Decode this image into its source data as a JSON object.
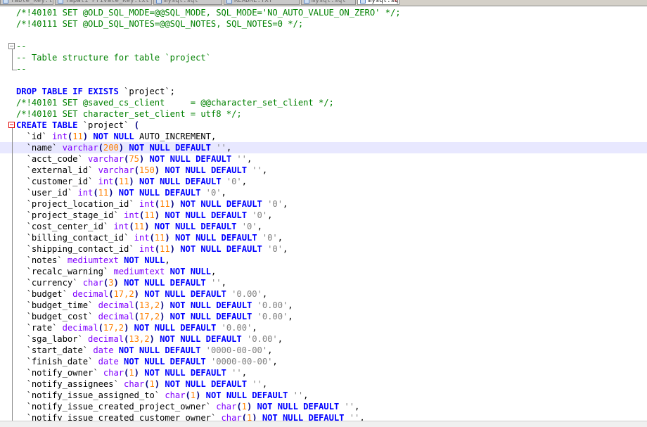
{
  "tabs": [
    {
      "label": "Table_Key.txt",
      "active": false
    },
    {
      "label": "Yapali Private_Key.txt",
      "active": false
    },
    {
      "label": "mysql.sql",
      "active": false
    },
    {
      "label": "README.TXT",
      "active": false
    },
    {
      "label": "mysql.sql",
      "active": false
    },
    {
      "label": "mysql.sql",
      "active": true
    }
  ],
  "icons": {
    "tab": "document-icon",
    "close": "close-icon",
    "fold_open": "fold-minus-icon"
  },
  "colors": {
    "comment": "#008000",
    "keyword": "#0000ff",
    "type": "#8000ff",
    "number": "#ff8000",
    "string": "#808080",
    "operator": "#000080",
    "current_line": "#e8e8ff",
    "fold_marker_active": "#e00000",
    "fold_marker": "#808080"
  },
  "editor": {
    "current_line_index": 12,
    "lines": [
      {
        "tokens": [
          {
            "t": "/*!40101 SET @OLD_SQL_MODE=@@SQL_MODE, SQL_MODE='NO_AUTO_VALUE_ON_ZERO' */;",
            "c": "comment"
          }
        ]
      },
      {
        "tokens": [
          {
            "t": "/*!40111 SET @OLD_SQL_NOTES=@@SQL_NOTES, SQL_NOTES=0 */;",
            "c": "comment"
          }
        ]
      },
      {
        "tokens": []
      },
      {
        "fold": "start",
        "tokens": [
          {
            "t": "--",
            "c": "comment"
          }
        ]
      },
      {
        "fold": "mid",
        "tokens": [
          {
            "t": "-- Table structure for table `project`",
            "c": "comment"
          }
        ]
      },
      {
        "fold": "end",
        "tokens": [
          {
            "t": "--",
            "c": "comment"
          }
        ]
      },
      {
        "tokens": []
      },
      {
        "tokens": [
          {
            "t": "DROP TABLE IF EXISTS",
            "c": "kw"
          },
          {
            "t": " `project`;",
            "c": "plain"
          }
        ]
      },
      {
        "tokens": [
          {
            "t": "/*!40101 SET @saved_cs_client     = @@character_set_client */;",
            "c": "comment"
          }
        ]
      },
      {
        "tokens": [
          {
            "t": "/*!40101 SET character_set_client = utf8 */;",
            "c": "comment"
          }
        ]
      },
      {
        "fold": "start-red",
        "tokens": [
          {
            "t": "CREATE TABLE",
            "c": "kw"
          },
          {
            "t": " `project` ",
            "c": "plain"
          },
          {
            "t": "(",
            "c": "op"
          }
        ]
      },
      {
        "fold": "mid",
        "tokens": [
          {
            "t": "  `id` ",
            "c": "plain"
          },
          {
            "t": "int",
            "c": "type"
          },
          {
            "t": "(",
            "c": "op"
          },
          {
            "t": "11",
            "c": "num"
          },
          {
            "t": ")",
            "c": "op"
          },
          {
            "t": " NOT NULL",
            "c": "kw"
          },
          {
            "t": " AUTO_INCREMENT,",
            "c": "plain"
          }
        ]
      },
      {
        "fold": "mid",
        "tokens": [
          {
            "t": "  `name` ",
            "c": "plain"
          },
          {
            "t": "varchar",
            "c": "type"
          },
          {
            "t": "(",
            "c": "op"
          },
          {
            "t": "200",
            "c": "num"
          },
          {
            "t": ")",
            "c": "op"
          },
          {
            "t": " NOT NULL DEFAULT",
            "c": "kw"
          },
          {
            "t": " ''",
            "c": "str"
          },
          {
            "t": ",",
            "c": "plain"
          }
        ]
      },
      {
        "fold": "mid",
        "tokens": [
          {
            "t": "  `acct_code` ",
            "c": "plain"
          },
          {
            "t": "varchar",
            "c": "type"
          },
          {
            "t": "(",
            "c": "op"
          },
          {
            "t": "75",
            "c": "num"
          },
          {
            "t": ")",
            "c": "op"
          },
          {
            "t": " NOT NULL DEFAULT",
            "c": "kw"
          },
          {
            "t": " ''",
            "c": "str"
          },
          {
            "t": ",",
            "c": "plain"
          }
        ]
      },
      {
        "fold": "mid",
        "tokens": [
          {
            "t": "  `external_id` ",
            "c": "plain"
          },
          {
            "t": "varchar",
            "c": "type"
          },
          {
            "t": "(",
            "c": "op"
          },
          {
            "t": "150",
            "c": "num"
          },
          {
            "t": ")",
            "c": "op"
          },
          {
            "t": " NOT NULL DEFAULT",
            "c": "kw"
          },
          {
            "t": " ''",
            "c": "str"
          },
          {
            "t": ",",
            "c": "plain"
          }
        ]
      },
      {
        "fold": "mid",
        "tokens": [
          {
            "t": "  `customer_id` ",
            "c": "plain"
          },
          {
            "t": "int",
            "c": "type"
          },
          {
            "t": "(",
            "c": "op"
          },
          {
            "t": "11",
            "c": "num"
          },
          {
            "t": ")",
            "c": "op"
          },
          {
            "t": " NOT NULL DEFAULT",
            "c": "kw"
          },
          {
            "t": " '0'",
            "c": "str"
          },
          {
            "t": ",",
            "c": "plain"
          }
        ]
      },
      {
        "fold": "mid",
        "tokens": [
          {
            "t": "  `user_id` ",
            "c": "plain"
          },
          {
            "t": "int",
            "c": "type"
          },
          {
            "t": "(",
            "c": "op"
          },
          {
            "t": "11",
            "c": "num"
          },
          {
            "t": ")",
            "c": "op"
          },
          {
            "t": " NOT NULL DEFAULT",
            "c": "kw"
          },
          {
            "t": " '0'",
            "c": "str"
          },
          {
            "t": ",",
            "c": "plain"
          }
        ]
      },
      {
        "fold": "mid",
        "tokens": [
          {
            "t": "  `project_location_id` ",
            "c": "plain"
          },
          {
            "t": "int",
            "c": "type"
          },
          {
            "t": "(",
            "c": "op"
          },
          {
            "t": "11",
            "c": "num"
          },
          {
            "t": ")",
            "c": "op"
          },
          {
            "t": " NOT NULL DEFAULT",
            "c": "kw"
          },
          {
            "t": " '0'",
            "c": "str"
          },
          {
            "t": ",",
            "c": "plain"
          }
        ]
      },
      {
        "fold": "mid",
        "tokens": [
          {
            "t": "  `project_stage_id` ",
            "c": "plain"
          },
          {
            "t": "int",
            "c": "type"
          },
          {
            "t": "(",
            "c": "op"
          },
          {
            "t": "11",
            "c": "num"
          },
          {
            "t": ")",
            "c": "op"
          },
          {
            "t": " NOT NULL DEFAULT",
            "c": "kw"
          },
          {
            "t": " '0'",
            "c": "str"
          },
          {
            "t": ",",
            "c": "plain"
          }
        ]
      },
      {
        "fold": "mid",
        "tokens": [
          {
            "t": "  `cost_center_id` ",
            "c": "plain"
          },
          {
            "t": "int",
            "c": "type"
          },
          {
            "t": "(",
            "c": "op"
          },
          {
            "t": "11",
            "c": "num"
          },
          {
            "t": ")",
            "c": "op"
          },
          {
            "t": " NOT NULL DEFAULT",
            "c": "kw"
          },
          {
            "t": " '0'",
            "c": "str"
          },
          {
            "t": ",",
            "c": "plain"
          }
        ]
      },
      {
        "fold": "mid",
        "tokens": [
          {
            "t": "  `billing_contact_id` ",
            "c": "plain"
          },
          {
            "t": "int",
            "c": "type"
          },
          {
            "t": "(",
            "c": "op"
          },
          {
            "t": "11",
            "c": "num"
          },
          {
            "t": ")",
            "c": "op"
          },
          {
            "t": " NOT NULL DEFAULT",
            "c": "kw"
          },
          {
            "t": " '0'",
            "c": "str"
          },
          {
            "t": ",",
            "c": "plain"
          }
        ]
      },
      {
        "fold": "mid",
        "tokens": [
          {
            "t": "  `shipping_contact_id` ",
            "c": "plain"
          },
          {
            "t": "int",
            "c": "type"
          },
          {
            "t": "(",
            "c": "op"
          },
          {
            "t": "11",
            "c": "num"
          },
          {
            "t": ")",
            "c": "op"
          },
          {
            "t": " NOT NULL DEFAULT",
            "c": "kw"
          },
          {
            "t": " '0'",
            "c": "str"
          },
          {
            "t": ",",
            "c": "plain"
          }
        ]
      },
      {
        "fold": "mid",
        "tokens": [
          {
            "t": "  `notes` ",
            "c": "plain"
          },
          {
            "t": "mediumtext",
            "c": "type"
          },
          {
            "t": " NOT NULL",
            "c": "kw"
          },
          {
            "t": ",",
            "c": "plain"
          }
        ]
      },
      {
        "fold": "mid",
        "tokens": [
          {
            "t": "  `recalc_warning` ",
            "c": "plain"
          },
          {
            "t": "mediumtext",
            "c": "type"
          },
          {
            "t": " NOT NULL",
            "c": "kw"
          },
          {
            "t": ",",
            "c": "plain"
          }
        ]
      },
      {
        "fold": "mid",
        "tokens": [
          {
            "t": "  `currency` ",
            "c": "plain"
          },
          {
            "t": "char",
            "c": "type"
          },
          {
            "t": "(",
            "c": "op"
          },
          {
            "t": "3",
            "c": "num"
          },
          {
            "t": ")",
            "c": "op"
          },
          {
            "t": " NOT NULL DEFAULT",
            "c": "kw"
          },
          {
            "t": " ''",
            "c": "str"
          },
          {
            "t": ",",
            "c": "plain"
          }
        ]
      },
      {
        "fold": "mid",
        "tokens": [
          {
            "t": "  `budget` ",
            "c": "plain"
          },
          {
            "t": "decimal",
            "c": "type"
          },
          {
            "t": "(",
            "c": "op"
          },
          {
            "t": "17,2",
            "c": "num"
          },
          {
            "t": ")",
            "c": "op"
          },
          {
            "t": " NOT NULL DEFAULT",
            "c": "kw"
          },
          {
            "t": " '0.00'",
            "c": "str"
          },
          {
            "t": ",",
            "c": "plain"
          }
        ]
      },
      {
        "fold": "mid",
        "tokens": [
          {
            "t": "  `budget_time` ",
            "c": "plain"
          },
          {
            "t": "decimal",
            "c": "type"
          },
          {
            "t": "(",
            "c": "op"
          },
          {
            "t": "13,2",
            "c": "num"
          },
          {
            "t": ")",
            "c": "op"
          },
          {
            "t": " NOT NULL DEFAULT",
            "c": "kw"
          },
          {
            "t": " '0.00'",
            "c": "str"
          },
          {
            "t": ",",
            "c": "plain"
          }
        ]
      },
      {
        "fold": "mid",
        "tokens": [
          {
            "t": "  `budget_cost` ",
            "c": "plain"
          },
          {
            "t": "decimal",
            "c": "type"
          },
          {
            "t": "(",
            "c": "op"
          },
          {
            "t": "17,2",
            "c": "num"
          },
          {
            "t": ")",
            "c": "op"
          },
          {
            "t": " NOT NULL DEFAULT",
            "c": "kw"
          },
          {
            "t": " '0.00'",
            "c": "str"
          },
          {
            "t": ",",
            "c": "plain"
          }
        ]
      },
      {
        "fold": "mid",
        "tokens": [
          {
            "t": "  `rate` ",
            "c": "plain"
          },
          {
            "t": "decimal",
            "c": "type"
          },
          {
            "t": "(",
            "c": "op"
          },
          {
            "t": "17,2",
            "c": "num"
          },
          {
            "t": ")",
            "c": "op"
          },
          {
            "t": " NOT NULL DEFAULT",
            "c": "kw"
          },
          {
            "t": " '0.00'",
            "c": "str"
          },
          {
            "t": ",",
            "c": "plain"
          }
        ]
      },
      {
        "fold": "mid",
        "tokens": [
          {
            "t": "  `sga_labor` ",
            "c": "plain"
          },
          {
            "t": "decimal",
            "c": "type"
          },
          {
            "t": "(",
            "c": "op"
          },
          {
            "t": "13,2",
            "c": "num"
          },
          {
            "t": ")",
            "c": "op"
          },
          {
            "t": " NOT NULL DEFAULT",
            "c": "kw"
          },
          {
            "t": " '0.00'",
            "c": "str"
          },
          {
            "t": ",",
            "c": "plain"
          }
        ]
      },
      {
        "fold": "mid",
        "tokens": [
          {
            "t": "  `start_date` ",
            "c": "plain"
          },
          {
            "t": "date",
            "c": "type"
          },
          {
            "t": " NOT NULL DEFAULT",
            "c": "kw"
          },
          {
            "t": " '0000-00-00'",
            "c": "str"
          },
          {
            "t": ",",
            "c": "plain"
          }
        ]
      },
      {
        "fold": "mid",
        "tokens": [
          {
            "t": "  `finish_date` ",
            "c": "plain"
          },
          {
            "t": "date",
            "c": "type"
          },
          {
            "t": " NOT NULL DEFAULT",
            "c": "kw"
          },
          {
            "t": " '0000-00-00'",
            "c": "str"
          },
          {
            "t": ",",
            "c": "plain"
          }
        ]
      },
      {
        "fold": "mid",
        "tokens": [
          {
            "t": "  `notify_owner` ",
            "c": "plain"
          },
          {
            "t": "char",
            "c": "type"
          },
          {
            "t": "(",
            "c": "op"
          },
          {
            "t": "1",
            "c": "num"
          },
          {
            "t": ")",
            "c": "op"
          },
          {
            "t": " NOT NULL DEFAULT",
            "c": "kw"
          },
          {
            "t": " ''",
            "c": "str"
          },
          {
            "t": ",",
            "c": "plain"
          }
        ]
      },
      {
        "fold": "mid",
        "tokens": [
          {
            "t": "  `notify_assignees` ",
            "c": "plain"
          },
          {
            "t": "char",
            "c": "type"
          },
          {
            "t": "(",
            "c": "op"
          },
          {
            "t": "1",
            "c": "num"
          },
          {
            "t": ")",
            "c": "op"
          },
          {
            "t": " NOT NULL DEFAULT",
            "c": "kw"
          },
          {
            "t": " ''",
            "c": "str"
          },
          {
            "t": ",",
            "c": "plain"
          }
        ]
      },
      {
        "fold": "mid",
        "tokens": [
          {
            "t": "  `notify_issue_assigned_to` ",
            "c": "plain"
          },
          {
            "t": "char",
            "c": "type"
          },
          {
            "t": "(",
            "c": "op"
          },
          {
            "t": "1",
            "c": "num"
          },
          {
            "t": ")",
            "c": "op"
          },
          {
            "t": " NOT NULL DEFAULT",
            "c": "kw"
          },
          {
            "t": " ''",
            "c": "str"
          },
          {
            "t": ",",
            "c": "plain"
          }
        ]
      },
      {
        "fold": "mid",
        "tokens": [
          {
            "t": "  `notify_issue_created_project_owner` ",
            "c": "plain"
          },
          {
            "t": "char",
            "c": "type"
          },
          {
            "t": "(",
            "c": "op"
          },
          {
            "t": "1",
            "c": "num"
          },
          {
            "t": ")",
            "c": "op"
          },
          {
            "t": " NOT NULL DEFAULT",
            "c": "kw"
          },
          {
            "t": " ''",
            "c": "str"
          },
          {
            "t": ",",
            "c": "plain"
          }
        ]
      },
      {
        "fold": "mid",
        "tokens": [
          {
            "t": "  `notify_issue_created_customer_owner` ",
            "c": "plain"
          },
          {
            "t": "char",
            "c": "type"
          },
          {
            "t": "(",
            "c": "op"
          },
          {
            "t": "1",
            "c": "num"
          },
          {
            "t": ")",
            "c": "op"
          },
          {
            "t": " NOT NULL DEFAULT",
            "c": "kw"
          },
          {
            "t": " ''",
            "c": "str"
          },
          {
            "t": ",",
            "c": "plain"
          }
        ]
      }
    ]
  }
}
